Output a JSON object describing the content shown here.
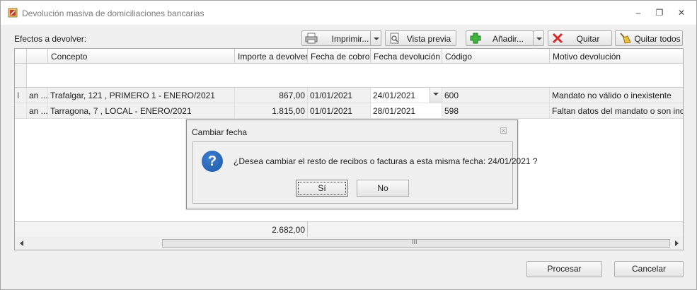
{
  "window": {
    "title": "Devolución masiva de domiciliaciones bancarias",
    "minimize": "–",
    "restore": "❐",
    "close": "✕"
  },
  "section_label": "Efectos a devolver:",
  "toolbar": {
    "print_label": "Imprimir...",
    "preview_label": "Vista previa",
    "add_label": "Añadir...",
    "remove_label": "Quitar",
    "remove_all_label": "Quitar todos"
  },
  "grid": {
    "columns": [
      "Concepto",
      "Importe a devolver",
      "Fecha de cobro",
      "Fecha devolución",
      "Código",
      "Motivo devolución"
    ],
    "rows": [
      {
        "indicator": "I",
        "col0": "an ...",
        "concepto": "Trafalgar, 121 , PRIMERO 1 - ENERO/2021",
        "importe": "867,00",
        "fecha_cobro": "01/01/2021",
        "fecha_devolucion": "24/01/2021",
        "codigo": "600",
        "motivo": "Mandato no válido o inexistente"
      },
      {
        "indicator": "",
        "col0": "an ...",
        "concepto": "Tarragona, 7 , LOCAL - ENERO/2021",
        "importe": "1.815,00",
        "fecha_cobro": "01/01/2021",
        "fecha_devolucion": "28/01/2021",
        "codigo": "598",
        "motivo": "Faltan datos del mandato o son inc..."
      }
    ],
    "total_importe": "2.682,00",
    "scroll_grip": "III"
  },
  "dialog": {
    "title": "Cambiar fecha",
    "close": "☒",
    "question_icon": "?",
    "message": "¿Desea cambiar el resto de recibos o facturas a esta misma fecha: 24/01/2021 ?",
    "yes_label": "Sí",
    "no_label": "No"
  },
  "footer": {
    "process_label": "Procesar",
    "cancel_label": "Cancelar"
  }
}
